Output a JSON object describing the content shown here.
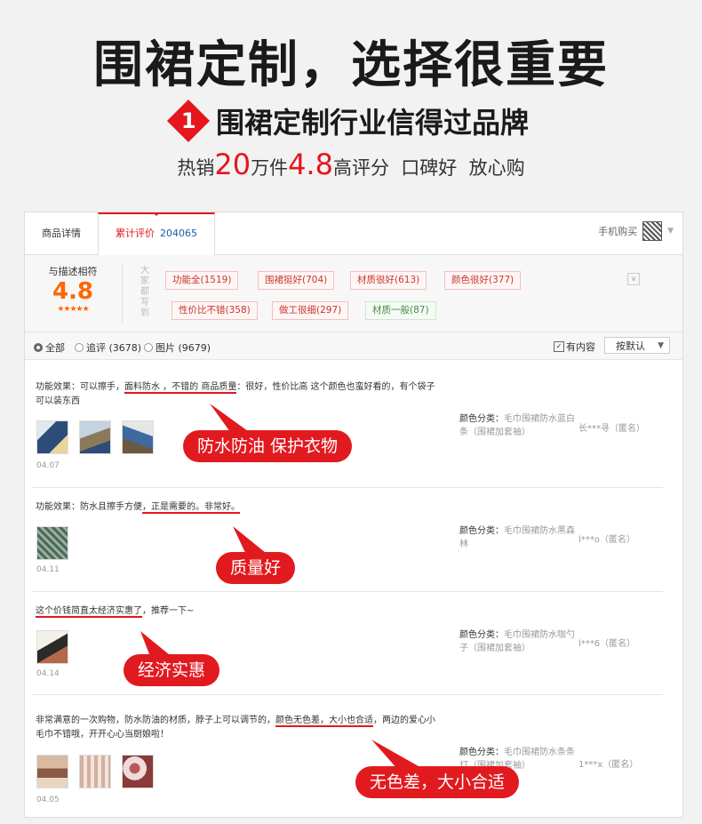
{
  "hero": {
    "title": "围裙定制，选择很重要",
    "badge_num": "1",
    "subtitle": "围裙定制行业信得过品牌",
    "sales_prefix": "热销",
    "sales_count": "20",
    "sales_unit": "万件",
    "rating": "4.8",
    "sales_suffix": "高评分  口碑好  放心购"
  },
  "tabs": {
    "detail": "商品详情",
    "review": "累计评价",
    "review_count": "204065",
    "mobile_buy": "手机购买"
  },
  "summary": {
    "label": "与描述相符",
    "score": "4.8",
    "stars": "★★★★★",
    "everyone": "大家都写到",
    "tags": [
      {
        "label": "功能全(1519)"
      },
      {
        "label": "围裙挺好(704)"
      },
      {
        "label": "材质很好(613)"
      },
      {
        "label": "颜色很好(377)"
      },
      {
        "label": "性价比不错(358)"
      },
      {
        "label": "做工很细(297)"
      },
      {
        "label": "材质一般(87)"
      }
    ],
    "expand": "∨"
  },
  "filter": {
    "all": "全部",
    "append": "追评 (3678)",
    "images": "图片 (9679)",
    "has_content": "有内容",
    "sort": "按默认"
  },
  "reviews": [
    {
      "text_a": "功能效果：可以擦手，",
      "text_b": "面料防水 ，不错的 商品质量",
      "text_c": "：很好，性价比高 这个颜色也蛮好看的，有个袋子可以装东西",
      "date": "04.07",
      "spec_key": "颜色分类：",
      "spec_val": "毛巾围裙防水蓝白条（围裙加套袖）",
      "user": "长***寻（匿名）",
      "callout": "防水防油 保护衣物"
    },
    {
      "text_a": "功能效果：防水且擦手方便",
      "text_b": "，正是需要的。非常好。",
      "text_c": "",
      "date": "04.11",
      "spec_key": "颜色分类：",
      "spec_val": "毛巾围裙防水黑森林",
      "user": "l***o（匿名）",
      "callout": "质量好"
    },
    {
      "text_a": "",
      "text_b": "这个价钱简直太经济实惠了",
      "text_c": "，推荐一下~",
      "date": "04.14",
      "spec_key": "颜色分类：",
      "spec_val": "毛巾围裙防水咖勺子（围裙加套袖）",
      "user": "l***6（匿名）",
      "callout": "经济实惠"
    },
    {
      "text_a": "非常满意的一次购物，防水防油的材质，脖子上可以调节的，",
      "text_b": "颜色无色差，大小也合适",
      "text_c": "，两边的爱心小毛巾不错哦，开开心心当厨娘啦！",
      "date": "04.05",
      "spec_key": "颜色分类：",
      "spec_val": "毛巾围裙防水条条灯（围裙加套袖）",
      "user": "1***x（匿名）",
      "callout": "无色差，大小合适"
    }
  ],
  "colors": {
    "accent": "#e5161d",
    "rating": "#ff6600",
    "link": "#1e5aa8"
  }
}
